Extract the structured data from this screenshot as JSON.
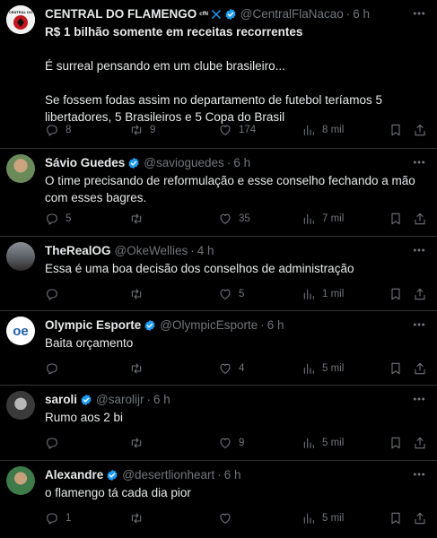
{
  "tweets": [
    {
      "name": "CENTRAL DO FLAMENGO",
      "name_suffix": "ᶜᶠᴺ",
      "handle": "@CentralFlaNacao",
      "time": "6 h",
      "avatar_text": "CENTRAL DO",
      "lines": [
        "R$ 1 bilhão somente em receitas recorrentes",
        "",
        "É surreal pensando em um clube brasileiro...",
        "",
        "Se fossem fodas assim no departamento de futebol teríamos 5 libertadores, 5 Brasileiros e 5 Copa do Brasil"
      ],
      "replies": "8",
      "retweets": "9",
      "likes": "174",
      "views": "8 mil"
    },
    {
      "name": "Sávio Guedes",
      "handle": "@savioguedes",
      "time": "6 h",
      "lines": [
        "O time precisando de reformulação e esse conselho fechando a mão com esses bagres."
      ],
      "replies": "5",
      "retweets": "",
      "likes": "35",
      "views": "7 mil"
    },
    {
      "name": "TheRealOG",
      "handle": "@OkeWellies",
      "time": "4 h",
      "lines": [
        "Essa é uma boa decisão dos conselhos de administração"
      ],
      "replies": "",
      "retweets": "",
      "likes": "5",
      "views": "1 mil"
    },
    {
      "name": "Olympic Esporte",
      "handle": "@OlympicEsporte",
      "time": "6 h",
      "avatar_text": "oe",
      "lines": [
        "Baita orçamento"
      ],
      "replies": "",
      "retweets": "",
      "likes": "4",
      "views": "5 mil"
    },
    {
      "name": "saroli",
      "handle": "@sarolijr",
      "time": "6 h",
      "lines": [
        "Rumo aos 2 bi"
      ],
      "replies": "",
      "retweets": "",
      "likes": "9",
      "views": "5 mil"
    },
    {
      "name": "Alexandre",
      "handle": "@desertlionheart",
      "time": "6 h",
      "lines": [
        "o flamengo tá cada dia pior"
      ],
      "replies": "1",
      "retweets": "",
      "likes": "",
      "views": "5 mil"
    }
  ],
  "colors": {
    "background": "#000000",
    "text": "#e7e9ea",
    "muted": "#71767b",
    "verified": "#1d9bf0",
    "divider": "#2f3336"
  },
  "icons": {
    "reply": "reply-icon",
    "retweet": "retweet-icon",
    "like": "heart-icon",
    "views": "views-icon",
    "bookmark": "bookmark-icon",
    "share": "share-icon",
    "more": "more-icon",
    "verified": "verified-badge-icon",
    "x_logo": "x-logo-icon"
  }
}
